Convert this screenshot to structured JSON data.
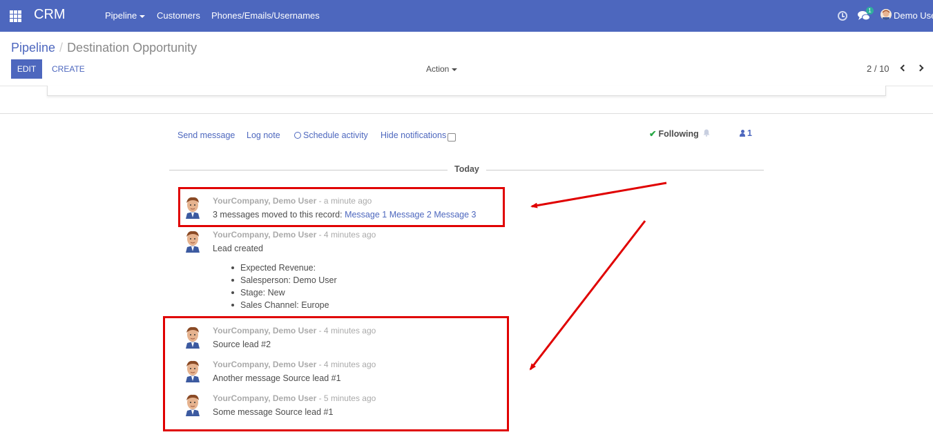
{
  "navbar": {
    "brand": "CRM",
    "menus": [
      {
        "label": "Pipeline"
      },
      {
        "label": "Customers"
      },
      {
        "label": "Phones/Emails/Usernames"
      }
    ],
    "chat_badge": "1",
    "user_name": "Demo Use"
  },
  "breadcrumb": {
    "parent": "Pipeline",
    "current": "Destination Opportunity"
  },
  "buttons": {
    "edit": "EDIT",
    "create": "CREATE",
    "action": "Action"
  },
  "pager": {
    "value": "2 / 10"
  },
  "chatter": {
    "send_message": "Send message",
    "log_note": "Log note",
    "schedule_activity": "Schedule activity",
    "hide_notifications": "Hide notifications",
    "following": "Following",
    "followers_count": "1",
    "day_label": "Today"
  },
  "messages": [
    {
      "author": "YourCompany, Demo User",
      "date": " - a minute ago",
      "body_prefix": "3 messages moved to this record: ",
      "links": [
        "Message 1",
        "Message 2",
        "Message 3"
      ]
    },
    {
      "author": "YourCompany, Demo User",
      "date": " - 4 minutes ago",
      "body": "Lead created",
      "tracking": [
        "Expected Revenue:",
        "Salesperson: Demo User",
        "Stage: New",
        "Sales Channel: Europe"
      ]
    },
    {
      "author": "YourCompany, Demo User",
      "date": " - 4 minutes ago",
      "body": "Source lead #2"
    },
    {
      "author": "YourCompany, Demo User",
      "date": " - 4 minutes ago",
      "body": "Another message Source lead #1"
    },
    {
      "author": "YourCompany, Demo User",
      "date": " - 5 minutes ago",
      "body": "Some message Source lead #1"
    }
  ],
  "colors": {
    "brand": "#4d67be",
    "annotation": "#e00000",
    "badge": "#2fae9d"
  }
}
